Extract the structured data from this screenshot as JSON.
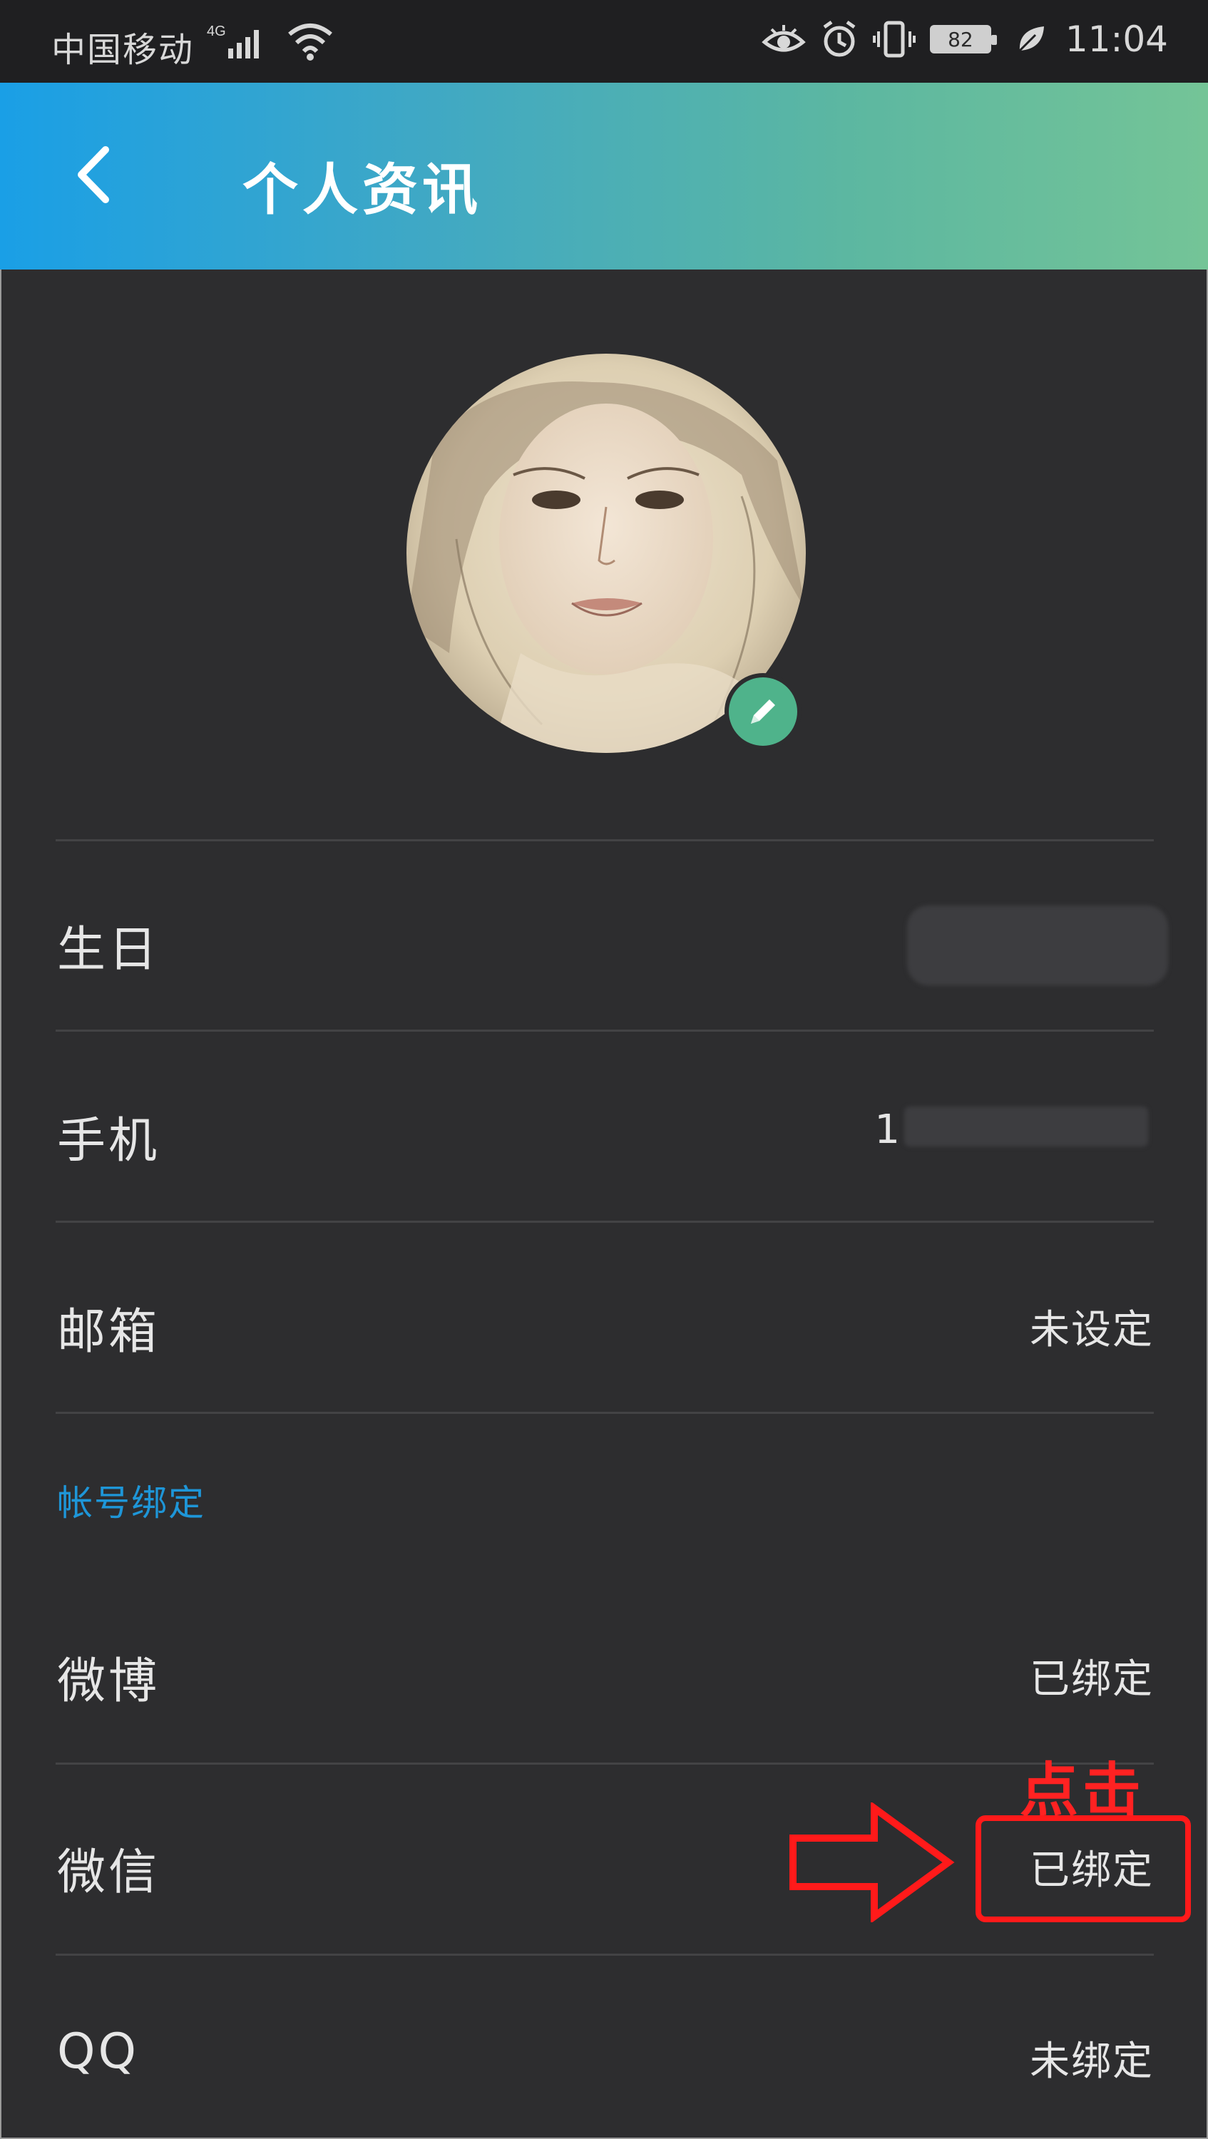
{
  "status_bar": {
    "carrier": "中国移动",
    "network": "4G",
    "battery": "82",
    "time": "11:04"
  },
  "header": {
    "title": "个人资讯"
  },
  "rows": [
    {
      "label": "生日",
      "value": ""
    },
    {
      "label": "手机",
      "value": "1"
    },
    {
      "label": "邮箱",
      "value": "未设定"
    }
  ],
  "section": {
    "title": "帐号绑定"
  },
  "bindings": [
    {
      "label": "微博",
      "value": "已绑定"
    },
    {
      "label": "微信",
      "value": "已绑定"
    },
    {
      "label": "QQ",
      "value": "未绑定"
    }
  ],
  "annotation": {
    "text": "点击"
  },
  "colors": {
    "accent": "#1e96d8",
    "edit_badge": "#4fb38b",
    "annotation": "#ff1a1a"
  },
  "icons": {
    "back": "chevron-left-icon",
    "edit": "pencil-icon",
    "status": [
      "signal-icon",
      "wifi-icon",
      "eye-icon",
      "alarm-icon",
      "vibrate-icon",
      "battery-icon",
      "leaf-icon"
    ]
  }
}
